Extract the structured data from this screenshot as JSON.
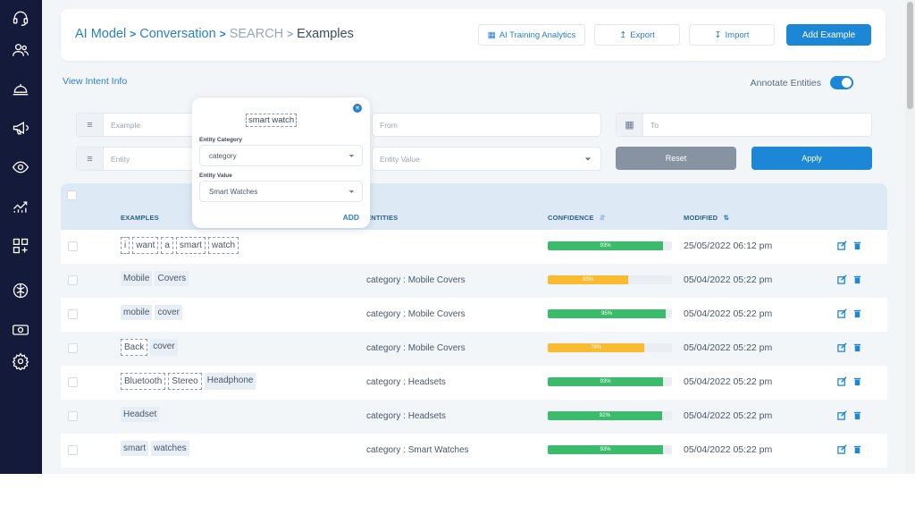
{
  "sidebar": {
    "icons": [
      "headset-icon",
      "users-icon",
      "service-bell-icon",
      "megaphone-icon",
      "eye-icon",
      "analytics-icon",
      "apps-add-icon",
      "brain-icon",
      "cash-icon",
      "settings-icon"
    ]
  },
  "breadcrumb": {
    "item1": "AI Model",
    "item2": "Conversation",
    "item3": "SEARCH",
    "item4": "Examples"
  },
  "header_buttons": {
    "analytics": "AI Training Analytics",
    "export": "Export",
    "import": "Import",
    "add": "Add Example"
  },
  "view_intent": "View Intent Info",
  "annotate_label": "Annotate Entities",
  "filters": {
    "example_placeholder": "Example",
    "from_placeholder": "From",
    "to_placeholder": "To",
    "entity_placeholder": "Entity",
    "entity_value_placeholder": "Entity Value",
    "reset": "Reset",
    "apply": "Apply"
  },
  "table": {
    "headers": {
      "examples": "EXAMPLES",
      "entities": "ENTITIES",
      "confidence": "CONFIDENCE",
      "modified": "MODIFIED"
    },
    "rows": [
      {
        "tokens": [
          "i",
          "want",
          "a",
          "smart",
          "watch"
        ],
        "entity": "",
        "confidence": 93,
        "confidence_label": "93%",
        "modified": "25/05/2022 06:12 pm"
      },
      {
        "tokens": [
          "Mobile",
          "Covers"
        ],
        "entity": "category : Mobile Covers",
        "confidence": 65,
        "confidence_label": "65%",
        "modified": "05/04/2022 05:22 pm"
      },
      {
        "tokens": [
          "mobile",
          "cover"
        ],
        "entity": "category : Mobile Covers",
        "confidence": 95,
        "confidence_label": "95%",
        "modified": "05/04/2022 05:22 pm"
      },
      {
        "tokens": [
          "Back",
          "cover"
        ],
        "entity": "category : Mobile Covers",
        "confidence": 78,
        "confidence_label": "78%",
        "modified": "05/04/2022 05:22 pm"
      },
      {
        "tokens": [
          "Bluetooth",
          "Stereo",
          "Headphone"
        ],
        "entity": "category : Headsets",
        "confidence": 93,
        "confidence_label": "93%",
        "modified": "05/04/2022 05:22 pm"
      },
      {
        "tokens": [
          "Headset"
        ],
        "entity": "category : Headsets",
        "confidence": 92,
        "confidence_label": "92%",
        "modified": "05/04/2022 05:22 pm"
      },
      {
        "tokens": [
          "smart",
          "watches"
        ],
        "entity": "category : Smart Watches",
        "confidence": 93,
        "confidence_label": "93%",
        "modified": "05/04/2022 05:22 pm"
      }
    ]
  },
  "popup": {
    "selected_text": "smart watch",
    "category_label": "Entity Category",
    "category_value": "category",
    "value_label": "Entity Value",
    "value_value": "Smart Watches",
    "add": "ADD"
  },
  "colors": {
    "primary": "#1c87d6",
    "sidebar": "#131a3a",
    "green": "#3dbb6c",
    "amber": "#fbbb30",
    "reset": "#8793a0"
  }
}
